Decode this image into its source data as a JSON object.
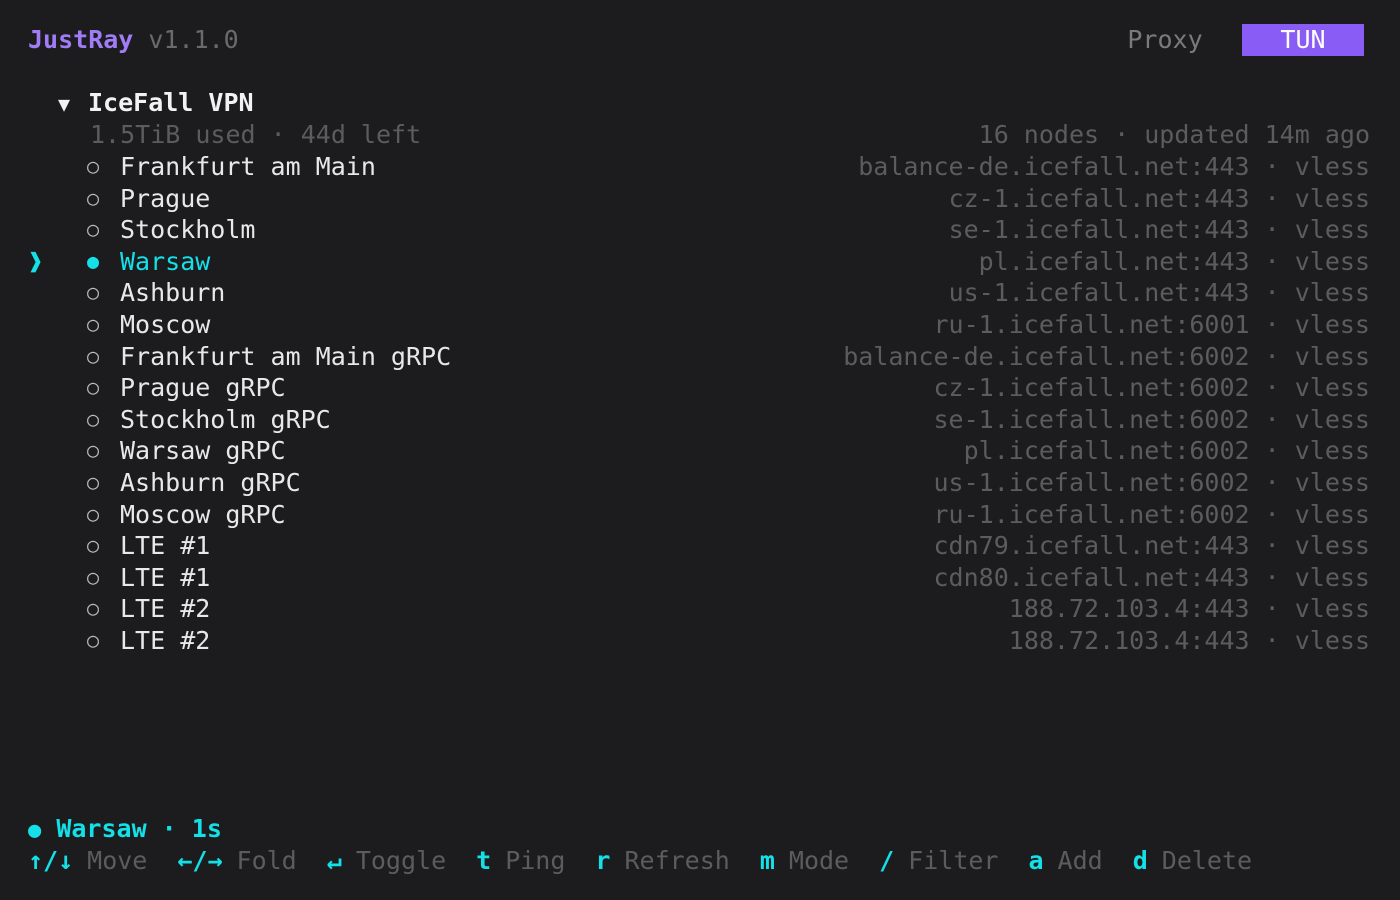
{
  "header": {
    "app_name": "JustRay",
    "version": "v1.1.0",
    "modes": [
      {
        "label": "Proxy",
        "active": false
      },
      {
        "label": "TUN",
        "active": true
      }
    ]
  },
  "group": {
    "expanded_icon": "triangle-down-icon",
    "arrow": "▼",
    "name": "IceFall VPN",
    "usage": "1.5TiB used · 44d left",
    "summary": "16 nodes · updated 14m ago"
  },
  "nodes": [
    {
      "name": "Frankfurt am Main",
      "address": "balance-de.icefall.net:443 · vless",
      "selected": false
    },
    {
      "name": "Prague",
      "address": "cz-1.icefall.net:443 · vless",
      "selected": false
    },
    {
      "name": "Stockholm",
      "address": "se-1.icefall.net:443 · vless",
      "selected": false
    },
    {
      "name": "Warsaw",
      "address": "pl.icefall.net:443 · vless",
      "selected": true
    },
    {
      "name": "Ashburn",
      "address": "us-1.icefall.net:443 · vless",
      "selected": false
    },
    {
      "name": "Moscow",
      "address": "ru-1.icefall.net:6001 · vless",
      "selected": false
    },
    {
      "name": "Frankfurt am Main gRPC",
      "address": "balance-de.icefall.net:6002 · vless",
      "selected": false
    },
    {
      "name": "Prague gRPC",
      "address": "cz-1.icefall.net:6002 · vless",
      "selected": false
    },
    {
      "name": "Stockholm gRPC",
      "address": "se-1.icefall.net:6002 · vless",
      "selected": false
    },
    {
      "name": "Warsaw gRPC",
      "address": "pl.icefall.net:6002 · vless",
      "selected": false
    },
    {
      "name": "Ashburn gRPC",
      "address": "us-1.icefall.net:6002 · vless",
      "selected": false
    },
    {
      "name": "Moscow gRPC",
      "address": "ru-1.icefall.net:6002 · vless",
      "selected": false
    },
    {
      "name": "LTE #1",
      "address": "cdn79.icefall.net:443 · vless",
      "selected": false
    },
    {
      "name": "LTE #1",
      "address": "cdn80.icefall.net:443 · vless",
      "selected": false
    },
    {
      "name": "LTE #2",
      "address": "188.72.103.4:443 · vless",
      "selected": false
    },
    {
      "name": "LTE #2",
      "address": "188.72.103.4:443 · vless",
      "selected": false
    }
  ],
  "glyphs": {
    "cursor": "❱",
    "dot_filled": "●",
    "dot_empty": "○"
  },
  "status": {
    "dot": "●",
    "text": "Warsaw · 1s"
  },
  "hints": [
    {
      "key": "↑/↓",
      "label": "Move"
    },
    {
      "key": "←/→",
      "label": "Fold"
    },
    {
      "key": "↵",
      "label": "Toggle"
    },
    {
      "key": "t",
      "label": "Ping"
    },
    {
      "key": "r",
      "label": "Refresh"
    },
    {
      "key": "m",
      "label": "Mode"
    },
    {
      "key": "/",
      "label": "Filter"
    },
    {
      "key": "a",
      "label": "Add"
    },
    {
      "key": "d",
      "label": "Delete"
    }
  ],
  "colors": {
    "background": "#1c1c1e",
    "accent_cyan": "#14e0e8",
    "accent_purple": "#8a5cf6",
    "app_name": "#a07cf6",
    "dim_text": "#5c5c5c"
  }
}
